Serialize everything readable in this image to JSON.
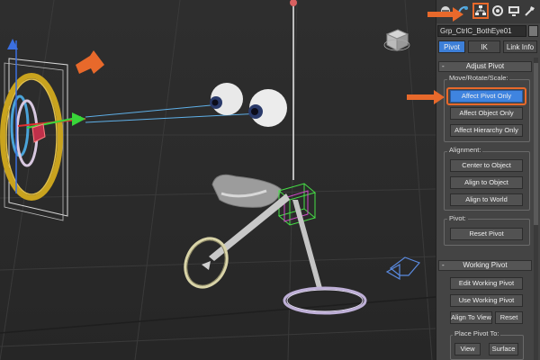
{
  "object_name": "Grp_CtrlC_BothEye01",
  "modes": {
    "pivot": "Pivot",
    "ik": "IK",
    "link_info": "Link Info"
  },
  "adjust_pivot": {
    "title": "Adjust Pivot",
    "sign": "-",
    "move_group_label": "Move/Rotate/Scale:",
    "affect_pivot_only": "Affect Pivot Only",
    "affect_object_only": "Affect Object Only",
    "affect_hierarchy_only": "Affect Hierarchy Only",
    "alignment_label": "Alignment:",
    "center_to_object": "Center to Object",
    "align_to_object": "Align to Object",
    "align_to_world": "Align to World",
    "pivot_label": "Pivot:",
    "reset_pivot": "Reset Pivot"
  },
  "working_pivot": {
    "title": "Working Pivot",
    "sign": "-",
    "edit_working_pivot": "Edit Working Pivot",
    "use_working_pivot": "Use Working Pivot",
    "align_to_view": "Align To View",
    "reset": "Reset",
    "place_pivot_label": "Place Pivot To:",
    "view": "View",
    "surface": "Surface"
  },
  "colors": {
    "accent_orange": "#e8692b",
    "active_blue": "#3f84e0",
    "panel_bg": "#444444",
    "viewport_bg": "#2b2b2b"
  },
  "icons": [
    "create-icon",
    "modify-icon",
    "hierarchy-icon",
    "motion-icon",
    "display-icon",
    "utilities-icon",
    "viewcube-icon"
  ]
}
